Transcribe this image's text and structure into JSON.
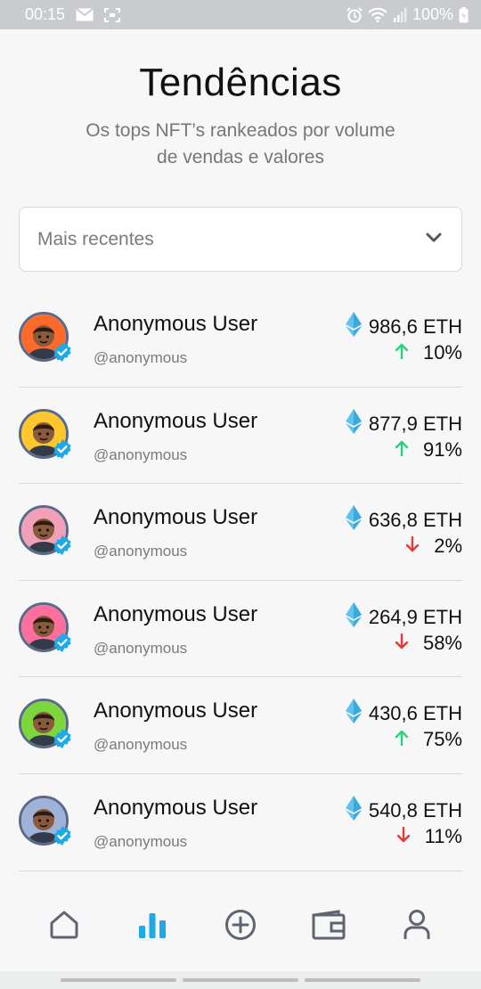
{
  "status_bar": {
    "time": "00:15",
    "battery": "100%",
    "icons": [
      "mail-icon",
      "screenshot-icon",
      "alarm-icon",
      "wifi-icon",
      "signal-icon",
      "battery-charging-icon"
    ]
  },
  "header": {
    "title": "Tendências",
    "subtitle": "Os tops NFT’s rankeados por volume de vendas e valores"
  },
  "filter": {
    "selected": "Mais recentes",
    "icon": "chevron-down-icon"
  },
  "users": [
    {
      "name": "Anonymous User",
      "handle": "@anonymous",
      "price": "986,6 ETH",
      "change": "10%",
      "direction": "up",
      "avatar_bg": "#ff6a2a"
    },
    {
      "name": "Anonymous User",
      "handle": "@anonymous",
      "price": "877,9 ETH",
      "change": "91%",
      "direction": "up",
      "avatar_bg": "#ffc72c"
    },
    {
      "name": "Anonymous User",
      "handle": "@anonymous",
      "price": "636,8 ETH",
      "change": "2%",
      "direction": "down",
      "avatar_bg": "#f1a0b8"
    },
    {
      "name": "Anonymous User",
      "handle": "@anonymous",
      "price": "264,9 ETH",
      "change": "58%",
      "direction": "down",
      "avatar_bg": "#ff6f9e"
    },
    {
      "name": "Anonymous User",
      "handle": "@anonymous",
      "price": "430,6 ETH",
      "change": "75%",
      "direction": "up",
      "avatar_bg": "#7ed63f"
    },
    {
      "name": "Anonymous User",
      "handle": "@anonymous",
      "price": "540,8 ETH",
      "change": "11%",
      "direction": "down",
      "avatar_bg": "#9fb3d8"
    }
  ],
  "nav": {
    "items": [
      {
        "icon": "home-icon",
        "active": false
      },
      {
        "icon": "bar-chart-icon",
        "active": true
      },
      {
        "icon": "add-circle-icon",
        "active": false
      },
      {
        "icon": "wallet-icon",
        "active": false
      },
      {
        "icon": "profile-icon",
        "active": false
      }
    ]
  },
  "colors": {
    "accent": "#1fa9e6",
    "up": "#27d37a",
    "down": "#e53935",
    "eth": "#5fc3ef",
    "nav_icon": "#5f6470"
  }
}
